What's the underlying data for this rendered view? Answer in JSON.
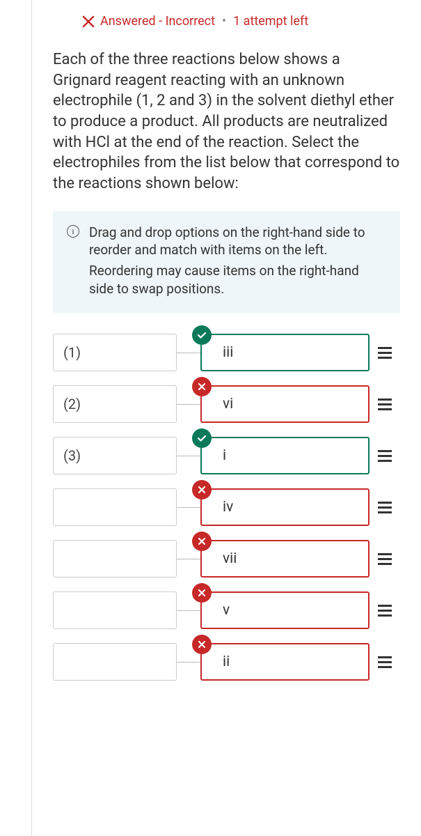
{
  "status": {
    "text": "Answered - Incorrect",
    "attempts": "1 attempt left"
  },
  "question": "Each of the three reactions below shows a Grignard reagent reacting with an unknown electrophile (1, 2 and 3) in the solvent diethyl ether to produce a product. All products are neutralized with HCl at the end of the reaction. Select the electrophiles from the list below that correspond to the reactions shown below:",
  "info": {
    "line1": "Drag and drop options on the right-hand side to reorder and match with items on the left.",
    "line2": "Reordering may cause items on the right-hand side to swap positions."
  },
  "left_items": [
    {
      "label": "(1)"
    },
    {
      "label": "(2)"
    },
    {
      "label": "(3)"
    },
    {
      "label": ""
    },
    {
      "label": ""
    },
    {
      "label": ""
    },
    {
      "label": ""
    }
  ],
  "right_items": [
    {
      "label": "iii",
      "state": "correct"
    },
    {
      "label": "vi",
      "state": "incorrect"
    },
    {
      "label": "i",
      "state": "correct"
    },
    {
      "label": "iv",
      "state": "incorrect"
    },
    {
      "label": "vii",
      "state": "incorrect"
    },
    {
      "label": "v",
      "state": "incorrect"
    },
    {
      "label": "ii",
      "state": "incorrect"
    }
  ]
}
